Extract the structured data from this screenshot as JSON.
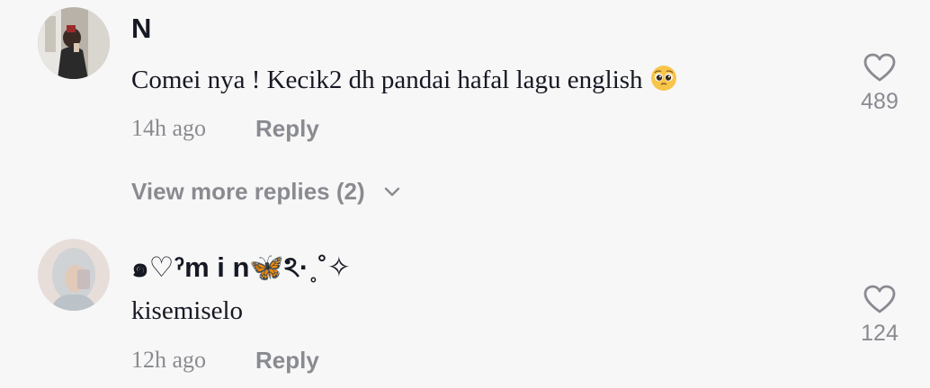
{
  "comments": [
    {
      "username": "N",
      "text": "Comei nya ! Kecik2 dh pandai hafal lagu english",
      "emoji": "pleading-face",
      "time": "14h ago",
      "reply_label": "Reply",
      "likes": "489",
      "icon": "heart-outline-icon"
    },
    {
      "username": "๑♡ˀm i n🦋ঽ·˳˚✧",
      "text": "kisemiselo",
      "time": "12h ago",
      "reply_label": "Reply",
      "likes": "124",
      "icon": "heart-outline-icon"
    }
  ],
  "view_more": {
    "label": "View more replies (2)",
    "icon": "chevron-down-icon"
  },
  "colors": {
    "background": "#f7f7f7",
    "text": "#161823",
    "secondary": "#8a8b91"
  }
}
